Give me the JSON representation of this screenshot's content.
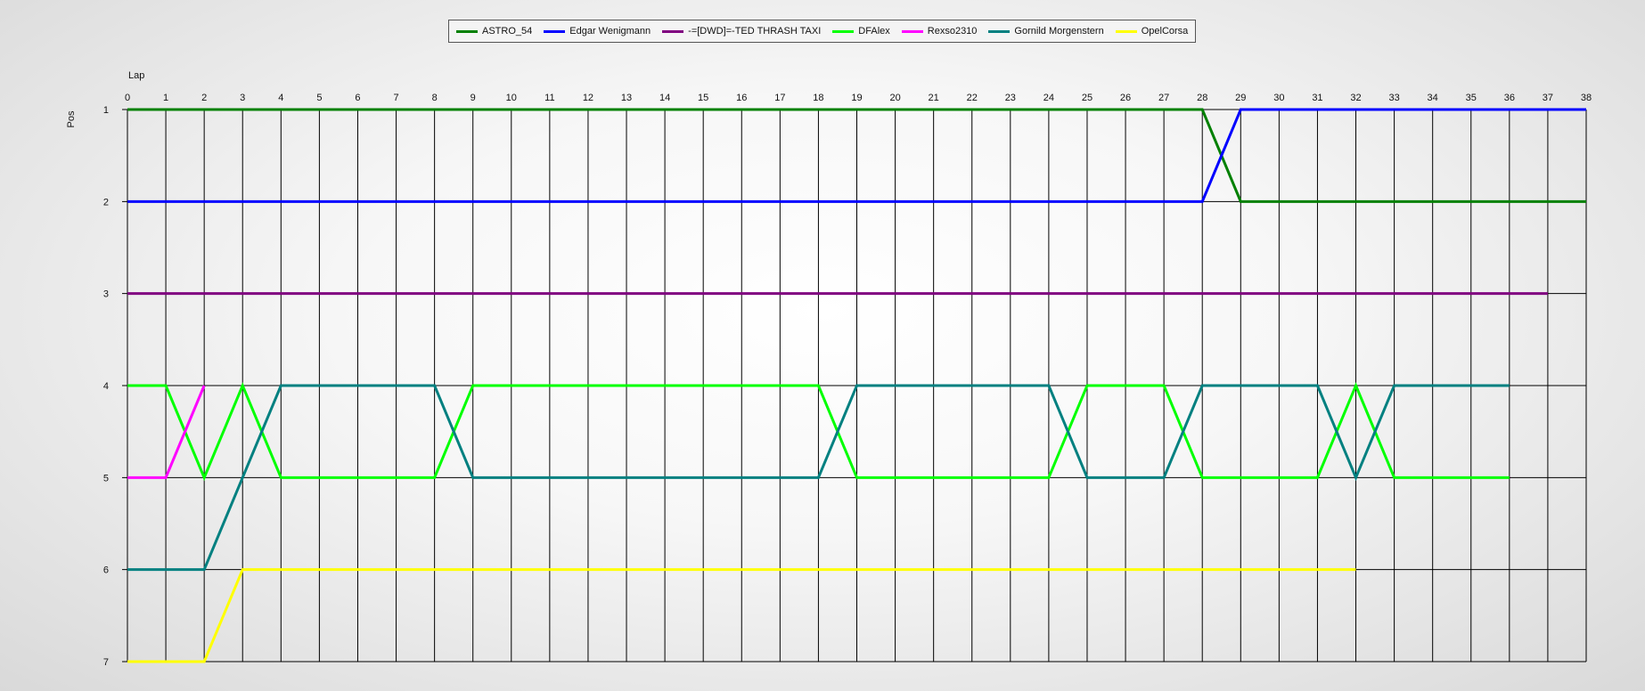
{
  "chart_data": {
    "type": "line",
    "xlabel": "Lap",
    "ylabel": "Pos",
    "x_ticks": [
      0,
      1,
      2,
      3,
      4,
      5,
      6,
      7,
      8,
      9,
      10,
      11,
      12,
      13,
      14,
      15,
      16,
      17,
      18,
      19,
      20,
      21,
      22,
      23,
      24,
      25,
      26,
      27,
      28,
      29,
      30,
      31,
      32,
      33,
      34,
      35,
      36,
      37,
      38
    ],
    "y_ticks": [
      1,
      2,
      3,
      4,
      5,
      6,
      7
    ],
    "xlim": [
      0,
      38
    ],
    "ylim": [
      1,
      7
    ],
    "y_inverted": true,
    "grid": true,
    "legend_position": "top",
    "series": [
      {
        "name": "ASTRO_54",
        "color": "#008000",
        "x": [
          0,
          1,
          2,
          3,
          4,
          5,
          6,
          7,
          8,
          9,
          10,
          11,
          12,
          13,
          14,
          15,
          16,
          17,
          18,
          19,
          20,
          21,
          22,
          23,
          24,
          25,
          26,
          27,
          28,
          29,
          30,
          31,
          32,
          33,
          34,
          35,
          36,
          37,
          38
        ],
        "y": [
          1,
          1,
          1,
          1,
          1,
          1,
          1,
          1,
          1,
          1,
          1,
          1,
          1,
          1,
          1,
          1,
          1,
          1,
          1,
          1,
          1,
          1,
          1,
          1,
          1,
          1,
          1,
          1,
          1,
          2,
          2,
          2,
          2,
          2,
          2,
          2,
          2,
          2,
          2
        ]
      },
      {
        "name": "Edgar Wenigmann",
        "color": "#0000ff",
        "x": [
          0,
          1,
          2,
          3,
          4,
          5,
          6,
          7,
          8,
          9,
          10,
          11,
          12,
          13,
          14,
          15,
          16,
          17,
          18,
          19,
          20,
          21,
          22,
          23,
          24,
          25,
          26,
          27,
          28,
          29,
          30,
          31,
          32,
          33,
          34,
          35,
          36,
          37,
          38
        ],
        "y": [
          2,
          2,
          2,
          2,
          2,
          2,
          2,
          2,
          2,
          2,
          2,
          2,
          2,
          2,
          2,
          2,
          2,
          2,
          2,
          2,
          2,
          2,
          2,
          2,
          2,
          2,
          2,
          2,
          2,
          1,
          1,
          1,
          1,
          1,
          1,
          1,
          1,
          1,
          1
        ]
      },
      {
        "name": "-=[DWD]=-TED THRASH TAXI",
        "color": "#800080",
        "x": [
          0,
          1,
          2,
          3,
          4,
          5,
          6,
          7,
          8,
          9,
          10,
          11,
          12,
          13,
          14,
          15,
          16,
          17,
          18,
          19,
          20,
          21,
          22,
          23,
          24,
          25,
          26,
          27,
          28,
          29,
          30,
          31,
          32,
          33,
          34,
          35,
          36,
          37
        ],
        "y": [
          3,
          3,
          3,
          3,
          3,
          3,
          3,
          3,
          3,
          3,
          3,
          3,
          3,
          3,
          3,
          3,
          3,
          3,
          3,
          3,
          3,
          3,
          3,
          3,
          3,
          3,
          3,
          3,
          3,
          3,
          3,
          3,
          3,
          3,
          3,
          3,
          3,
          3
        ]
      },
      {
        "name": "DFAlex",
        "color": "#00ff00",
        "x": [
          0,
          1,
          2,
          3,
          4,
          5,
          6,
          7,
          8,
          9,
          10,
          11,
          12,
          13,
          14,
          15,
          16,
          17,
          18,
          19,
          20,
          21,
          22,
          23,
          24,
          25,
          26,
          27,
          28,
          29,
          30,
          31,
          32,
          33,
          34,
          35,
          36
        ],
        "y": [
          4,
          4,
          5,
          4,
          5,
          5,
          5,
          5,
          5,
          4,
          4,
          4,
          4,
          4,
          4,
          4,
          4,
          4,
          4,
          5,
          5,
          5,
          5,
          5,
          5,
          4,
          4,
          4,
          5,
          5,
          5,
          5,
          4,
          5,
          5,
          5,
          5
        ]
      },
      {
        "name": "Rexso2310",
        "color": "#ff00ff",
        "x": [
          0,
          1,
          2
        ],
        "y": [
          5,
          5,
          4
        ]
      },
      {
        "name": "Gornild Morgenstern",
        "color": "#008080",
        "x": [
          0,
          1,
          2,
          3,
          4,
          5,
          6,
          7,
          8,
          9,
          10,
          11,
          12,
          13,
          14,
          15,
          16,
          17,
          18,
          19,
          20,
          21,
          22,
          23,
          24,
          25,
          26,
          27,
          28,
          29,
          30,
          31,
          32,
          33,
          34,
          35,
          36
        ],
        "y": [
          6,
          6,
          6,
          5,
          4,
          4,
          4,
          4,
          4,
          5,
          5,
          5,
          5,
          5,
          5,
          5,
          5,
          5,
          5,
          4,
          4,
          4,
          4,
          4,
          4,
          5,
          5,
          5,
          4,
          4,
          4,
          4,
          5,
          4,
          4,
          4,
          4
        ]
      },
      {
        "name": "OpelCorsa",
        "color": "#ffff00",
        "x": [
          0,
          1,
          2,
          3,
          4,
          5,
          6,
          7,
          8,
          9,
          10,
          11,
          12,
          13,
          14,
          15,
          16,
          17,
          18,
          19,
          20,
          21,
          22,
          23,
          24,
          25,
          26,
          27,
          28,
          29,
          30,
          31,
          32
        ],
        "y": [
          7,
          7,
          7,
          6,
          6,
          6,
          6,
          6,
          6,
          6,
          6,
          6,
          6,
          6,
          6,
          6,
          6,
          6,
          6,
          6,
          6,
          6,
          6,
          6,
          6,
          6,
          6,
          6,
          6,
          6,
          6,
          6,
          6
        ]
      }
    ]
  }
}
